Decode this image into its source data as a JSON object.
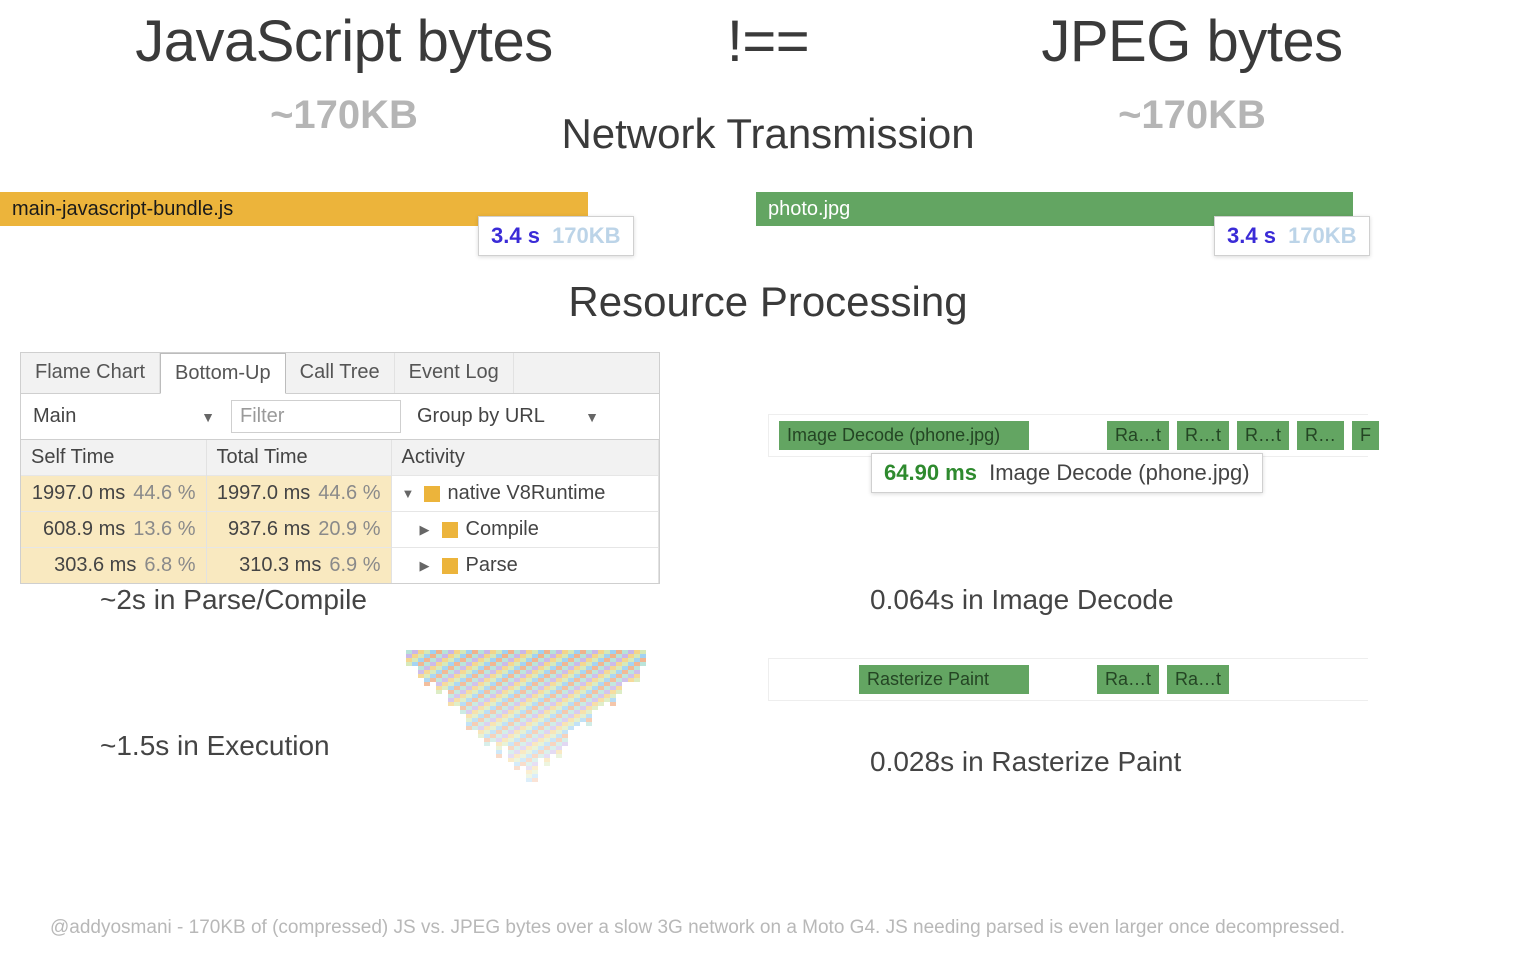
{
  "headline": {
    "left_title": "JavaScript bytes",
    "left_sub": "~170KB",
    "operator": "!==",
    "right_title": "JPEG bytes",
    "right_sub": "~170KB"
  },
  "sections": {
    "network": "Network Transmission",
    "processing": "Resource Processing"
  },
  "network": {
    "js_label": "main-javascript-bundle.js",
    "jpg_label": "photo.jpg",
    "badge_time": "3.4 s",
    "badge_size": "170KB"
  },
  "devtools": {
    "tabs": [
      "Flame Chart",
      "Bottom-Up",
      "Call Tree",
      "Event Log"
    ],
    "active_tab_index": 1,
    "thread_select": "Main",
    "filter_placeholder": "Filter",
    "group_select": "Group by URL",
    "columns": [
      "Self Time",
      "Total Time",
      "Activity"
    ],
    "rows": [
      {
        "self_ms": "1997.0 ms",
        "self_pct": "44.6 %",
        "total_ms": "1997.0 ms",
        "total_pct": "44.6 %",
        "indent": 0,
        "tri": "▼",
        "label": "native V8Runtime"
      },
      {
        "self_ms": "608.9 ms",
        "self_pct": "13.6 %",
        "total_ms": "937.6 ms",
        "total_pct": "20.9 %",
        "indent": 1,
        "tri": "▶",
        "label": "Compile"
      },
      {
        "self_ms": "303.6 ms",
        "self_pct": "6.8 %",
        "total_ms": "310.3 ms",
        "total_pct": "6.9 %",
        "indent": 1,
        "tri": "▶",
        "label": "Parse"
      }
    ]
  },
  "captions": {
    "parse_compile": "~2s in Parse/Compile",
    "execution": "~1.5s in Execution",
    "decode": "0.064s in Image Decode",
    "raster": "0.028s in Rasterize Paint"
  },
  "timeline": {
    "decode_boxes": [
      "Image Decode (phone.jpg)",
      "Ra…t",
      "R…t",
      "R…t",
      "R…",
      "F"
    ],
    "decode_tooltip_ms": "64.90 ms",
    "decode_tooltip_label": "Image Decode (phone.jpg)",
    "raster_boxes": [
      "Rasterize Paint",
      "Ra…t",
      "Ra…t"
    ]
  },
  "footer": "@addyosmani - 170KB of (compressed) JS vs. JPEG bytes over a slow 3G network on a Moto G4. JS needing parsed is even larger once decompressed."
}
